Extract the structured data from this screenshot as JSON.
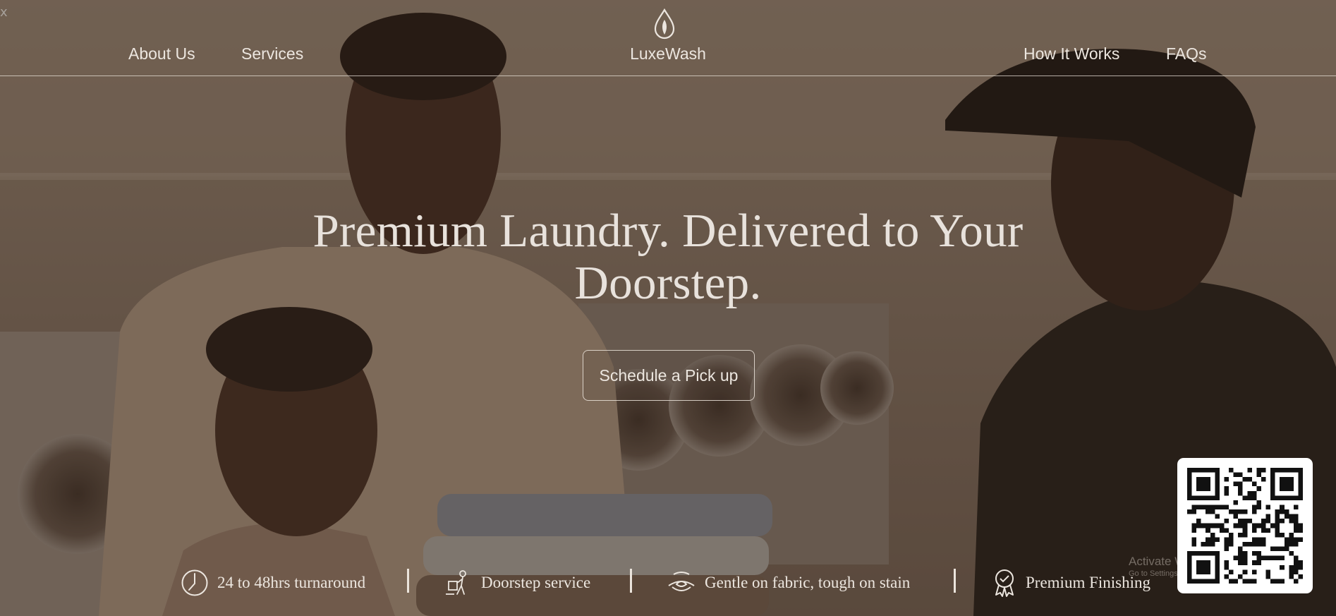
{
  "window": {
    "close_glyph": "x"
  },
  "nav": {
    "left_links": [
      "About Us",
      "Services"
    ],
    "brand": "LuxeWash",
    "brand_icon": "droplet-leaf-icon",
    "right_links": [
      "How It Works",
      "FAQs"
    ]
  },
  "hero": {
    "title": "Premium Laundry. Delivered to Your Doorstep.",
    "cta_label": "Schedule a Pick up"
  },
  "features": [
    {
      "icon": "clock-icon",
      "label": "24 to 48hrs turnaround"
    },
    {
      "icon": "delivery-person-icon",
      "label": "Doorstep service"
    },
    {
      "icon": "fabric-care-icon",
      "label": "Gentle on fabric, tough on stain"
    },
    {
      "icon": "award-ribbon-icon",
      "label": "Premium Finishing"
    }
  ],
  "watermark": {
    "title": "Activate Windows",
    "subtitle": "Go to Settings to activate Windows."
  },
  "qr": {
    "icon": "qr-code-icon"
  },
  "colors": {
    "overlay": "#3b2e24",
    "text": "#ece6df",
    "accent_border": "#ebe4dc"
  }
}
